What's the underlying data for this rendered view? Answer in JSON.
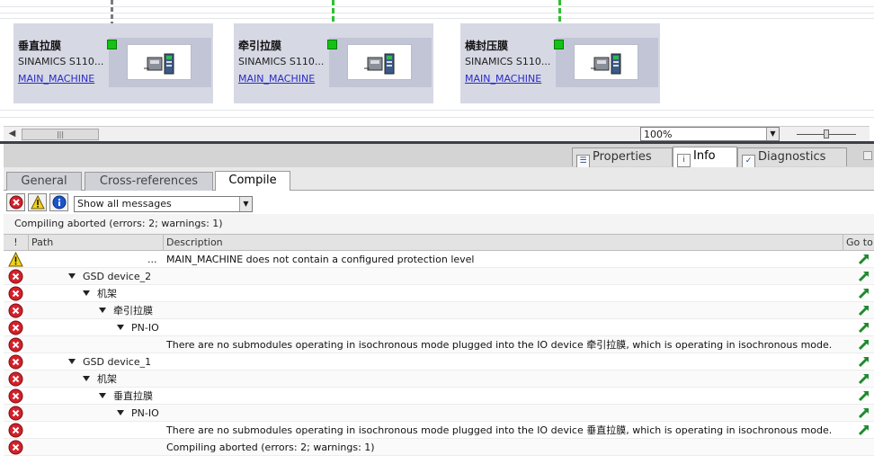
{
  "network": {
    "devices": [
      {
        "name": "垂直拉膜",
        "type": "SINAMICS S110...",
        "link": "MAIN_MACHINE"
      },
      {
        "name": "牵引拉膜",
        "type": "SINAMICS S110...",
        "link": "MAIN_MACHINE"
      },
      {
        "name": "横封压膜",
        "type": "SINAMICS S110...",
        "link": "MAIN_MACHINE"
      }
    ],
    "zoom": "100%"
  },
  "inspector_tabs": {
    "properties": "Properties",
    "info": "Info",
    "diagnostics": "Diagnostics"
  },
  "sub_tabs": {
    "general": "General",
    "cross_references": "Cross-references",
    "compile": "Compile"
  },
  "toolbar": {
    "filter_value": "Show all messages"
  },
  "status_text": "Compiling aborted (errors: 2; warnings: 1)",
  "columns": {
    "flag": "!",
    "path": "Path",
    "description": "Description",
    "goto": "Go to"
  },
  "messages": [
    {
      "severity": "warning",
      "path": "...",
      "indent": 0,
      "expandable": false,
      "description": "MAIN_MACHINE does not contain a configured protection level"
    },
    {
      "severity": "error",
      "path": "GSD device_2",
      "indent": 1,
      "expandable": true,
      "description": ""
    },
    {
      "severity": "error",
      "path": "机架",
      "indent": 2,
      "expandable": true,
      "description": ""
    },
    {
      "severity": "error",
      "path": "牵引拉膜",
      "indent": 3,
      "expandable": true,
      "description": ""
    },
    {
      "severity": "error",
      "path": "PN-IO",
      "indent": 4,
      "expandable": true,
      "description": ""
    },
    {
      "severity": "error",
      "path": "",
      "indent": 0,
      "expandable": false,
      "description": "There are no submodules operating in isochronous mode plugged into the IO device 牵引拉膜, which is operating in isochronous mode."
    },
    {
      "severity": "error",
      "path": "GSD device_1",
      "indent": 1,
      "expandable": true,
      "description": ""
    },
    {
      "severity": "error",
      "path": "机架",
      "indent": 2,
      "expandable": true,
      "description": ""
    },
    {
      "severity": "error",
      "path": "垂直拉膜",
      "indent": 3,
      "expandable": true,
      "description": ""
    },
    {
      "severity": "error",
      "path": "PN-IO",
      "indent": 4,
      "expandable": true,
      "description": ""
    },
    {
      "severity": "error",
      "path": "",
      "indent": 0,
      "expandable": false,
      "description": "There are no submodules operating in isochronous mode plugged into the IO device 垂直拉膜, which is operating in isochronous mode."
    },
    {
      "severity": "error",
      "path": "",
      "indent": 0,
      "expandable": false,
      "description": "Compiling aborted (errors: 2; warnings: 1)",
      "no_goto": true
    }
  ],
  "colors": {
    "error": "#d4202a",
    "warning": "#f2d21b",
    "goto": "#1f8a2e"
  }
}
